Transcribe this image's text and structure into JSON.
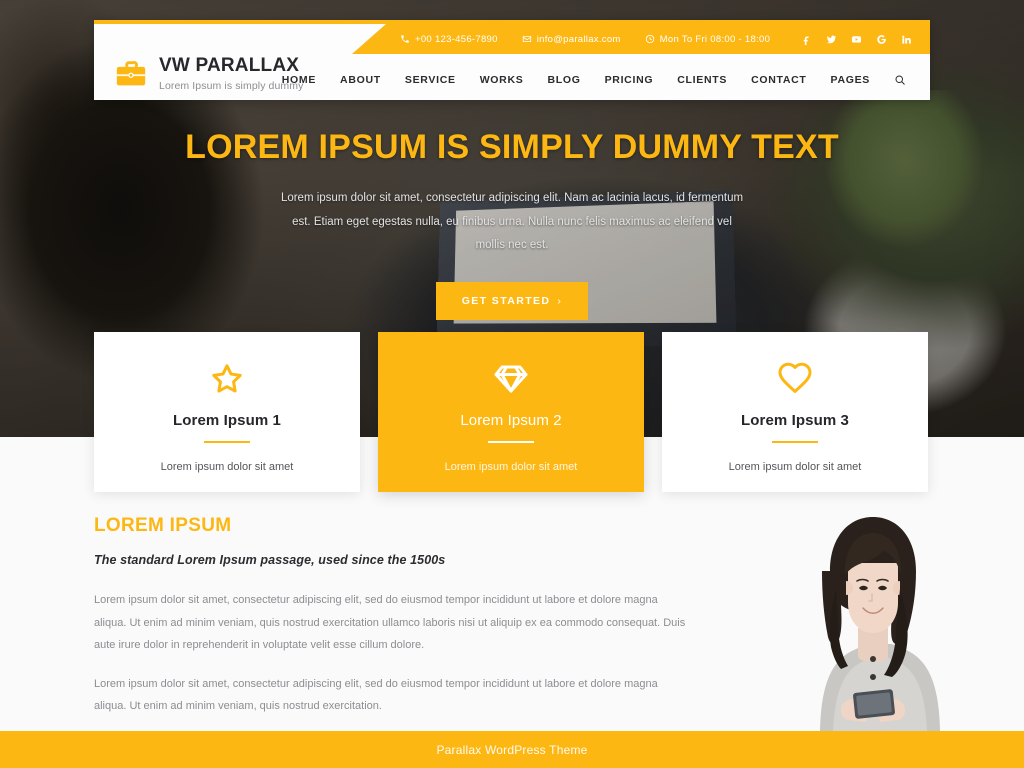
{
  "topbar": {
    "phone": "+00 123-456-7890",
    "email": "info@parallax.com",
    "hours": "Mon To Fri 08:00 - 18:00",
    "socials": [
      {
        "name": "facebook",
        "label": "f"
      },
      {
        "name": "twitter",
        "label": "t"
      },
      {
        "name": "youtube",
        "label": "yt"
      },
      {
        "name": "google",
        "label": "G"
      },
      {
        "name": "linkedin",
        "label": "in"
      }
    ]
  },
  "brand": {
    "title": "VW PARALLAX",
    "tagline": "Lorem Ipsum is simply dummy",
    "icon": "briefcase-icon"
  },
  "nav": {
    "items": [
      {
        "label": "HOME"
      },
      {
        "label": "ABOUT"
      },
      {
        "label": "SERVICE"
      },
      {
        "label": "WORKS"
      },
      {
        "label": "BLOG"
      },
      {
        "label": "PRICING"
      },
      {
        "label": "CLIENTS"
      },
      {
        "label": "CONTACT"
      },
      {
        "label": "PAGES"
      }
    ],
    "search_icon": "search-icon"
  },
  "hero": {
    "title": "LOREM IPSUM IS SIMPLY DUMMY TEXT",
    "text": "Lorem ipsum dolor sit amet, consectetur adipiscing elit. Nam ac lacinia lacus, id fermentum est. Etiam eget egestas nulla, eu finibus urna. Nulla nunc felis maximus ac eleifend vel mollis nec est.",
    "cta_label": "GET STARTED",
    "cta_chevron": "›"
  },
  "features": [
    {
      "icon": "star-icon",
      "title": "Lorem Ipsum 1",
      "desc": "Lorem ipsum dolor sit amet",
      "featured": false
    },
    {
      "icon": "diamond-icon",
      "title": "Lorem Ipsum 2",
      "desc": "Lorem ipsum dolor sit amet",
      "featured": true
    },
    {
      "icon": "heart-icon",
      "title": "Lorem Ipsum 3",
      "desc": "Lorem ipsum dolor sit amet",
      "featured": false
    }
  ],
  "about": {
    "kicker": "LOREM IPSUM",
    "subtitle": "The standard Lorem Ipsum passage, used since the 1500s",
    "paragraph1": "Lorem ipsum dolor sit amet, consectetur adipiscing elit, sed do eiusmod tempor incididunt ut labore et dolore magna aliqua. Ut enim ad minim veniam, quis nostrud exercitation ullamco laboris nisi ut aliquip ex ea commodo consequat. Duis aute irure dolor in reprehenderit in voluptate velit esse cillum dolore.",
    "paragraph2": "Lorem ipsum dolor sit amet, consectetur adipiscing elit, sed do eiusmod tempor incididunt ut labore et dolore magna aliqua. Ut enim ad minim veniam, quis nostrud exercitation.",
    "photo": "woman-with-phone-photo"
  },
  "footer": {
    "text": "Parallax WordPress Theme"
  },
  "colors": {
    "accent": "#FDB713",
    "dark_text": "#26262b",
    "muted_text": "#8d8d92",
    "card_bg": "#ffffff",
    "section_bg": "#fafafa"
  }
}
